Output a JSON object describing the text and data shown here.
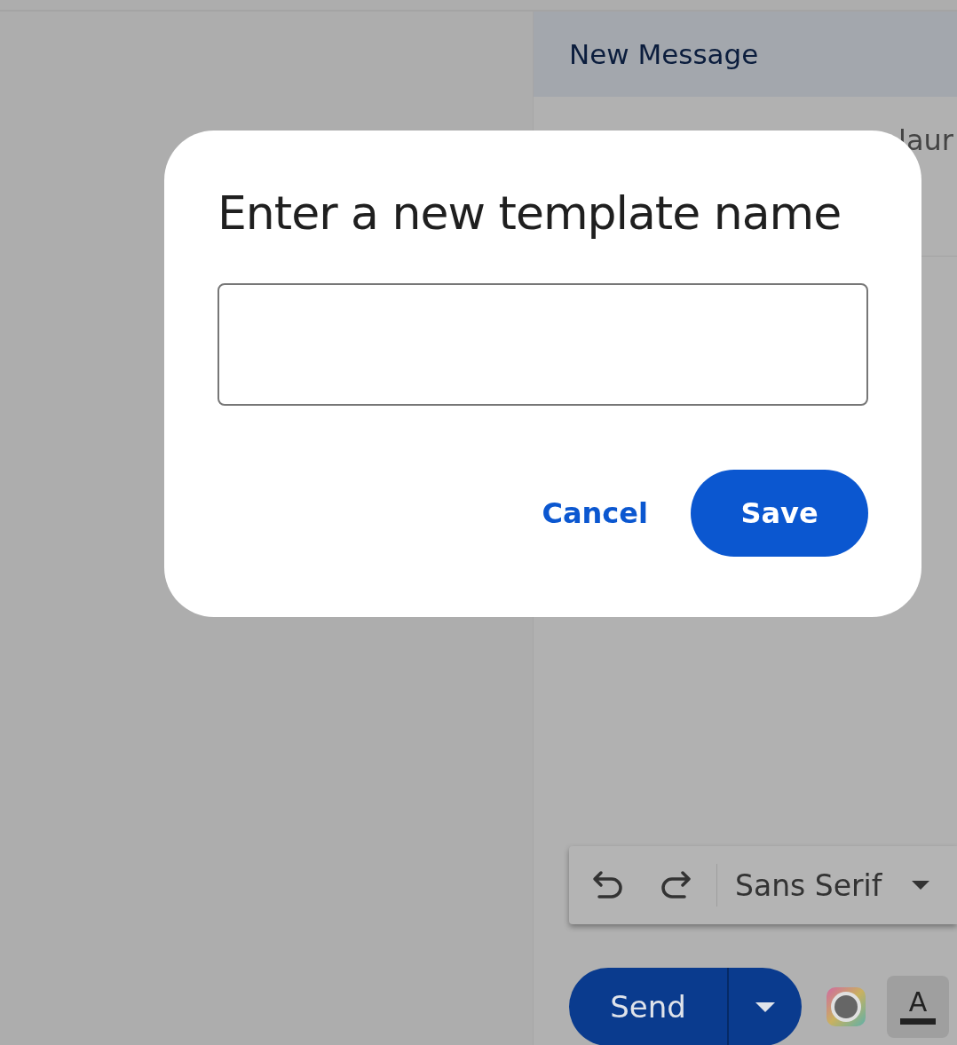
{
  "compose": {
    "title": "New Message",
    "recipient_fragment": "laur",
    "toolbar": {
      "font": "Sans Serif"
    },
    "send_button": "Send",
    "format_button": "A"
  },
  "dialog": {
    "title": "Enter a new template name",
    "buttons": [
      {
        "label": "Cancel",
        "kind": "text"
      },
      {
        "label": "Save",
        "kind": "filled"
      }
    ]
  }
}
